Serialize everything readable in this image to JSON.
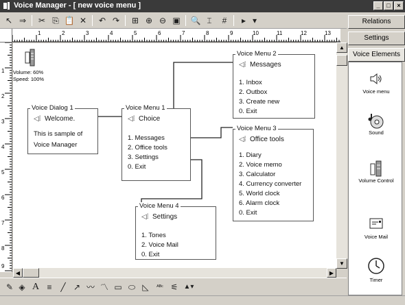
{
  "window": {
    "title": "Voice Manager - [ new voice menu ]",
    "controls": [
      "_",
      "□",
      "×"
    ]
  },
  "toolbar": {
    "icons": [
      "pointer-icon",
      "move-icon",
      "cut-icon",
      "copy-icon",
      "paste-icon",
      "delete-icon",
      "undo-icon",
      "redo-icon",
      "zoom-fit-icon",
      "zoom-in-icon",
      "zoom-out-icon",
      "zoom-page-icon",
      "search-icon",
      "text-cursor-icon",
      "grid-icon",
      "play-icon",
      "dropdown-icon"
    ],
    "glyphs": [
      "↖",
      "⇒",
      "✂",
      "⎘",
      "📋",
      "✕",
      "↶",
      "↷",
      "⊞",
      "⊕",
      "⊖",
      "▣",
      "🔍",
      "⌶",
      "#",
      "▸",
      "▾"
    ]
  },
  "ruler": {
    "h_numbers": [
      "1",
      "2",
      "3",
      "4",
      "5",
      "6",
      "7",
      "8",
      "9",
      "10",
      "11",
      "12",
      "13"
    ],
    "v_numbers": [
      "1",
      "2",
      "3",
      "4",
      "5",
      "6",
      "7",
      "8",
      "9"
    ]
  },
  "volume_widget": {
    "volume": "Volume: 60%",
    "speed": "Speed: 100%"
  },
  "nodes": {
    "dialog1": {
      "title": "Voice Dialog 1",
      "head": "Welcome.",
      "lines": [
        "This is sample of",
        "Voice Manager"
      ]
    },
    "menu1": {
      "title": "Voice Menu 1",
      "head": "Choice",
      "items": [
        "1. Messages",
        "2. Office tools",
        "3. Settings",
        "0. Exit"
      ]
    },
    "menu2": {
      "title": "Voice Menu 2",
      "head": "Messages",
      "items": [
        "1. Inbox",
        "2. Outbox",
        "3. Create new",
        "0. Exit"
      ]
    },
    "menu3": {
      "title": "Voice Menu 3",
      "head": "Office tools",
      "items": [
        "1. Diary",
        "2. Voice memo",
        "3. Calculator",
        "4. Currency converter",
        "5. World clock",
        "6. Alarm clock",
        "0. Exit"
      ]
    },
    "menu4": {
      "title": "Voice Menu 4",
      "head": "Settings",
      "items": [
        "1. Tones",
        "2. Voice Mail",
        "0. Exit"
      ]
    }
  },
  "right_panel": {
    "tabs": [
      "Relations",
      "Settings",
      "Voice Elements"
    ],
    "elements": [
      {
        "label": "Voice menu",
        "icon": "voice-menu-icon"
      },
      {
        "label": "Sound",
        "icon": "sound-icon"
      },
      {
        "label": "Volume Control",
        "icon": "volume-control-icon"
      },
      {
        "label": "Voice Mail",
        "icon": "voice-mail-icon"
      },
      {
        "label": "Timer",
        "icon": "timer-icon"
      }
    ]
  },
  "drawbar": {
    "icons": [
      "pen-icon",
      "fill-icon",
      "text-icon",
      "line-weight-icon",
      "line-icon",
      "arrow-icon",
      "freehand-icon",
      "polyline-icon",
      "rectangle-icon",
      "ellipse-icon",
      "polygon-icon",
      "text-box-icon",
      "color-icon",
      "image-icon"
    ],
    "glyphs": [
      "✎",
      "◈",
      "A",
      "≡",
      "╱",
      "↗",
      "〰",
      "〽",
      "▭",
      "⬭",
      "◺",
      "ᴬᴮᶜ",
      "⚟",
      "▲▾"
    ]
  }
}
